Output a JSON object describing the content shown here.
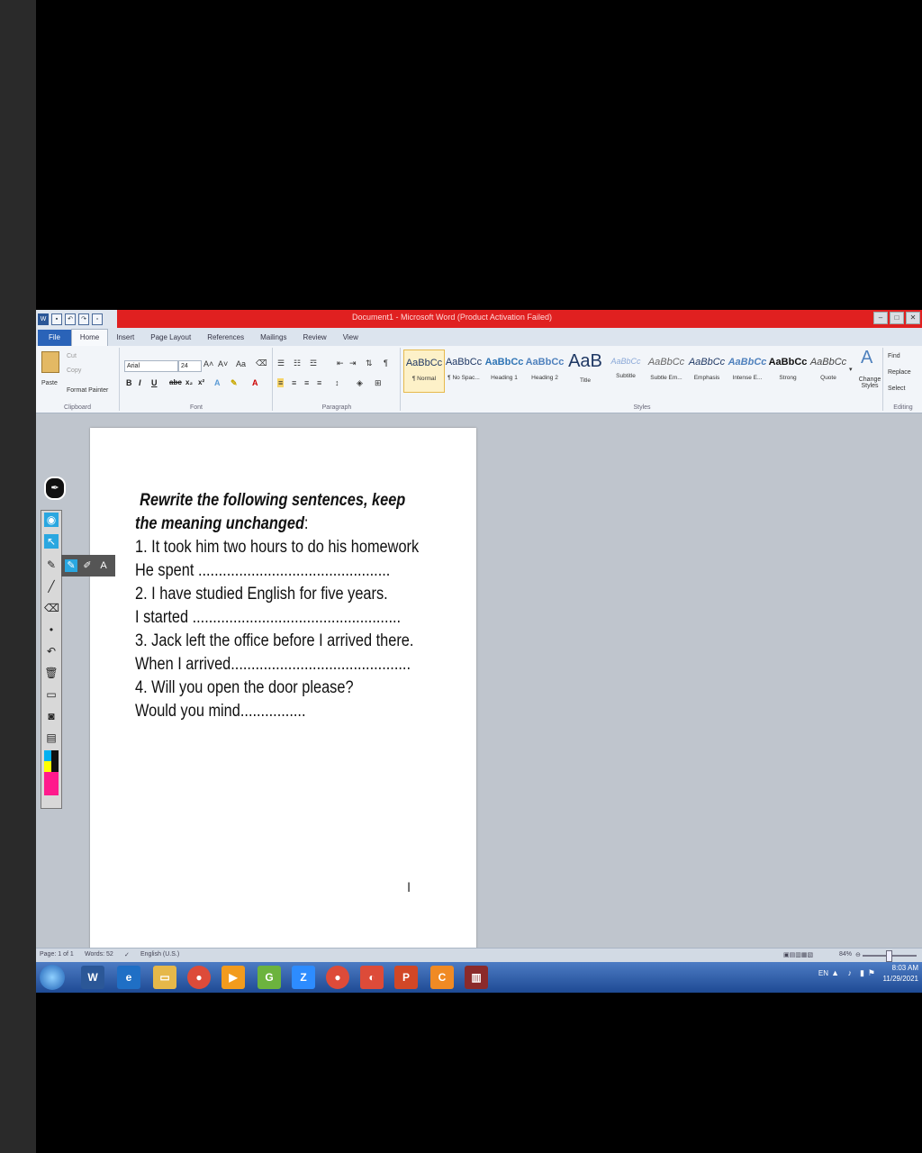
{
  "window": {
    "title": "Document1 - Microsoft Word (Product Activation Failed)",
    "buttons": [
      "–",
      "□",
      "✕"
    ]
  },
  "tabs": [
    "File",
    "Home",
    "Insert",
    "Page Layout",
    "References",
    "Mailings",
    "Review",
    "View"
  ],
  "ribbon": {
    "clipboard": {
      "paste": "Paste",
      "cut": "Cut",
      "copy": "Copy",
      "format_painter": "Format Painter",
      "label": "Clipboard"
    },
    "font": {
      "name": "Arial",
      "size": "24",
      "label": "Font"
    },
    "paragraph": {
      "label": "Paragraph"
    },
    "styles": {
      "label": "Styles",
      "items": [
        {
          "preview": "AaBbCc",
          "name": "¶ Normal"
        },
        {
          "preview": "AaBbCc",
          "name": "¶ No Spac..."
        },
        {
          "preview": "AaBbCc",
          "name": "Heading 1"
        },
        {
          "preview": "AaBbCc",
          "name": "Heading 2"
        },
        {
          "preview": "AaB",
          "name": "Title"
        },
        {
          "preview": "AaBbCc",
          "name": "Subtitle"
        },
        {
          "preview": "AaBbCc",
          "name": "Subtle Em..."
        },
        {
          "preview": "AaBbCc",
          "name": "Emphasis"
        },
        {
          "preview": "AaBbCc",
          "name": "Intense E..."
        },
        {
          "preview": "AaBbCc",
          "name": "Strong"
        },
        {
          "preview": "AaBbCc",
          "name": "Quote"
        }
      ],
      "change_styles": "Change Styles"
    },
    "editing": {
      "find": "Find",
      "replace": "Replace",
      "select": "Select",
      "label": "Editing"
    }
  },
  "document": {
    "heading_line1": "Rewrite the following sentences, keep",
    "heading_line2": "the meaning unchanged",
    "heading_colon": ":",
    "lines": [
      "1. It took him two hours to do his homework",
      "He spent ...............................................",
      "2. I have studied English for five years.",
      "I started ...................................................",
      "3.  Jack left the office before I arrived there.",
      "When I arrived............................................",
      "4. Will you open the door please?",
      "Would you mind................"
    ]
  },
  "statusbar": {
    "page": "Page: 1 of 1",
    "words": "Words: 52",
    "language": "English (U.S.)",
    "zoom": "84%"
  },
  "taskbar": {
    "lang": "EN",
    "time": "8:03 AM",
    "date": "11/29/2021"
  },
  "annotation_toolbar": {
    "text_tool": "A"
  }
}
